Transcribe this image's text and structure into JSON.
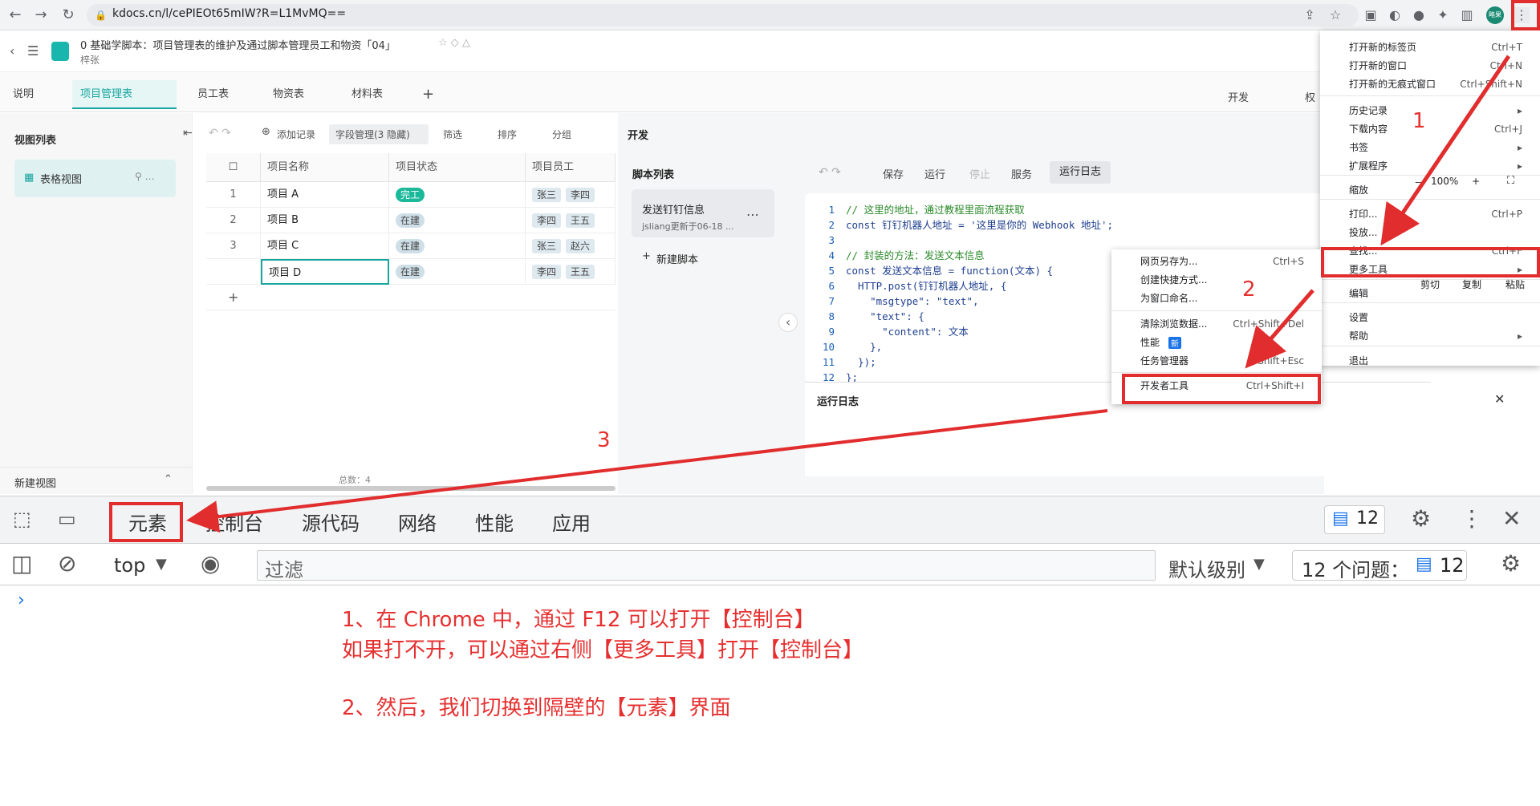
{
  "browser": {
    "url": "kdocs.cn/l/cePIEOt65mIW?R=L1MvMQ==",
    "avatar_label": "略果"
  },
  "doc": {
    "title": "0 基础学脚本：项目管理表的维护及通过脚本管理员工和物资「04」",
    "folder": "梓张"
  },
  "tabs": [
    "说明",
    "项目管理表",
    "员工表",
    "物资表",
    "材料表"
  ],
  "header_right": {
    "dev": "开发",
    "perm": "权"
  },
  "views": {
    "heading": "视图列表",
    "item": "表格视图",
    "new_view": "新建视图",
    "total": "总数：4"
  },
  "toolbar": {
    "add_record": "添加记录",
    "field_mgr": "字段管理(3 隐藏)",
    "filter": "筛选",
    "sort": "排序",
    "group": "分组"
  },
  "grid": {
    "columns": [
      "项目名称",
      "项目状态",
      "项目员工"
    ],
    "rows": [
      {
        "num": "1",
        "name": "项目 A",
        "status": "完工",
        "staff": [
          "张三",
          "李四"
        ]
      },
      {
        "num": "2",
        "name": "项目 B",
        "status": "在建",
        "staff": [
          "李四",
          "王五"
        ]
      },
      {
        "num": "3",
        "name": "项目 C",
        "status": "在建",
        "staff": [
          "张三",
          "赵六"
        ]
      },
      {
        "num": "",
        "name": "项目 D",
        "status": "在建",
        "staff": [
          "李四",
          "王五"
        ]
      }
    ],
    "add": "+"
  },
  "dev": {
    "title": "开发",
    "script_list": "脚本列表",
    "script_name": "发送钉钉信息",
    "script_meta": "jsliang更新于06-18 ...",
    "new_script": "新建脚本",
    "toolbar": [
      "保存",
      "运行",
      "停止",
      "服务",
      "运行日志"
    ],
    "log_title": "运行日志"
  },
  "code": [
    {
      "n": "1",
      "t": "// 这里的地址，通过教程里面流程获取"
    },
    {
      "n": "2",
      "t": "const 钉钉机器人地址 = '这里是你的 Webhook 地址';"
    },
    {
      "n": "3",
      "t": ""
    },
    {
      "n": "4",
      "t": "// 封装的方法：发送文本信息"
    },
    {
      "n": "5",
      "t": "const 发送文本信息 = function(文本) {"
    },
    {
      "n": "6",
      "t": "  HTTP.post(钉钉机器人地址, {"
    },
    {
      "n": "7",
      "t": "    \"msgtype\": \"text\","
    },
    {
      "n": "8",
      "t": "    \"text\": {"
    },
    {
      "n": "9",
      "t": "      \"content\": 文本"
    },
    {
      "n": "10",
      "t": "    },"
    },
    {
      "n": "11",
      "t": "  });"
    },
    {
      "n": "12",
      "t": "};"
    }
  ],
  "chrome_menu": [
    {
      "label": "打开新的标签页",
      "sc": "Ctrl+T"
    },
    {
      "label": "打开新的窗口",
      "sc": "Ctrl+N"
    },
    {
      "label": "打开新的无痕式窗口",
      "sc": "Ctrl+Shift+N"
    },
    {
      "label": "历史记录",
      "sc": "▸"
    },
    {
      "label": "下载内容",
      "sc": "Ctrl+J"
    },
    {
      "label": "书签",
      "sc": "▸"
    },
    {
      "label": "扩展程序",
      "sc": "▸"
    },
    {
      "label": "缩放",
      "sc": ""
    },
    {
      "label": "打印...",
      "sc": "Ctrl+P"
    },
    {
      "label": "投放...",
      "sc": ""
    },
    {
      "label": "查找...",
      "sc": "Ctrl+F"
    },
    {
      "label": "更多工具",
      "sc": "▸"
    },
    {
      "label": "编辑",
      "sc": ""
    },
    {
      "label": "设置",
      "sc": ""
    },
    {
      "label": "帮助",
      "sc": "▸"
    },
    {
      "label": "退出",
      "sc": ""
    }
  ],
  "zoom": {
    "minus": "－",
    "value": "100%",
    "plus": "+"
  },
  "edit": {
    "cut": "剪切",
    "copy": "复制",
    "paste": "粘贴"
  },
  "submenu": [
    {
      "label": "网页另存为...",
      "sc": "Ctrl+S"
    },
    {
      "label": "创建快捷方式...",
      "sc": ""
    },
    {
      "label": "为窗口命名...",
      "sc": ""
    },
    {
      "label": "清除浏览数据...",
      "sc": "Ctrl+Shift+Del"
    },
    {
      "label": "性能",
      "sc": ""
    },
    {
      "label": "任务管理器",
      "sc": "Shift+Esc"
    },
    {
      "label": "开发者工具",
      "sc": "Ctrl+Shift+I"
    }
  ],
  "new_badge": "新",
  "devtools": {
    "tabs": [
      "元素",
      "控制台",
      "源代码",
      "网络",
      "性能",
      "应用"
    ],
    "issues_badge": "12",
    "context": "top",
    "filter_placeholder": "过滤",
    "level": "默认级别",
    "issues": "12 个问题：",
    "issues_count": "12",
    "prompt": "›"
  },
  "annotations": {
    "n1": "1",
    "n2": "2",
    "n3": "3",
    "line1": "1、在 Chrome 中，通过 F12 可以打开【控制台】",
    "line2": "如果打不开，可以通过右侧【更多工具】打开【控制台】",
    "line3": "2、然后，我们切换到隔壁的【元素】界面"
  },
  "colors": {
    "accent": "#1aa6a0",
    "annotation": "#e12d2d"
  }
}
